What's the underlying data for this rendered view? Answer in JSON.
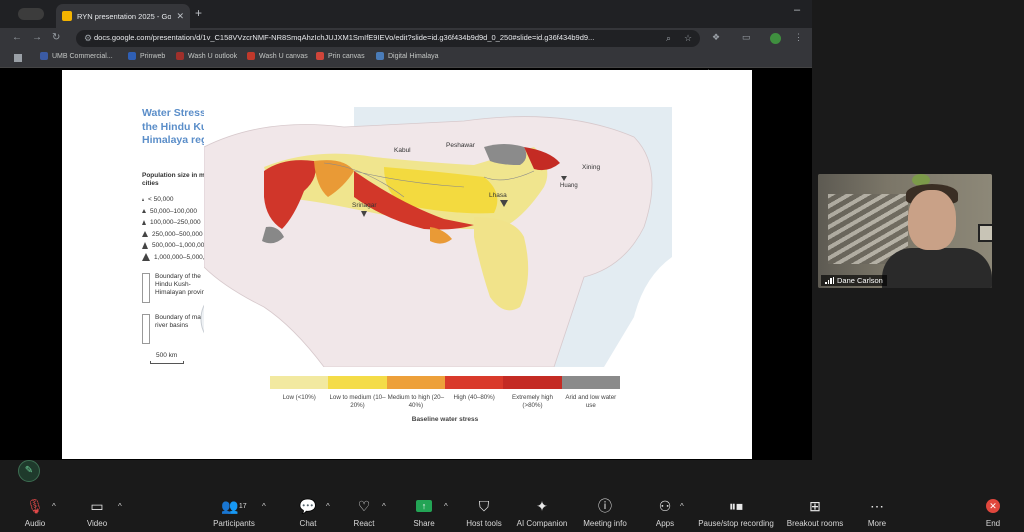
{
  "browser": {
    "tab_title": "RYN presentation 2025 - Goo",
    "tab_close": "✕",
    "new_tab": "+",
    "url": "docs.google.com/presentation/d/1v_C158VVzcrNMF-NR8SmqAhzIchJUJXM1SmIfE9IEVo/edit?slide=id.g36f434b9d9d_0_250#slide=id.g36f434b9d9...",
    "bookmarks": [
      {
        "label": "UMB Commercial...",
        "color": "#3b5ba5"
      },
      {
        "label": "Prinweb",
        "color": "#2f5fb5"
      },
      {
        "label": "Wash U outlook",
        "color": "#a0302b"
      },
      {
        "label": "Wash U canvas",
        "color": "#c0392b"
      },
      {
        "label": "Prin canvas",
        "color": "#d0453a"
      },
      {
        "label": "Digital Himalaya",
        "color": "#4a7cb8"
      }
    ]
  },
  "slide": {
    "map_title": "Water Stress in the Hindu Kush-Himalaya region",
    "population_heading": "Population size in main cities",
    "population_sizes": [
      "< 50,000",
      "50,000–100,000",
      "100,000–250,000",
      "250,000–500,000",
      "500,000–1,000,000",
      "1,000,000–5,000,000"
    ],
    "boundary_hkh": "Boundary of the Hindu Kush-Himalayan province",
    "boundary_basins": "Boundary of mayor river basins",
    "scale": "500 km",
    "place_labels": {
      "kabul": "Kabul",
      "peshawar": "Peshawar",
      "xining": "Xining",
      "lhasa": "Lhasa",
      "srinagar": "Srinagar",
      "huang": "Huang"
    },
    "legend": [
      {
        "label": "Low (<10%)",
        "color": "#f2e9a0"
      },
      {
        "label": "Low to medium (10–20%)",
        "color": "#f4dc48"
      },
      {
        "label": "Medium to high (20–40%)",
        "color": "#eda03a"
      },
      {
        "label": "High (40–80%)",
        "color": "#d93a2b"
      },
      {
        "label": "Extremely high (>80%)",
        "color": "#c42b24"
      },
      {
        "label": "Arid and low water use",
        "color": "#8a8a8a"
      }
    ],
    "legend_caption": "Baseline water stress"
  },
  "participant": {
    "name": "Dane Carlson"
  },
  "controls": {
    "audio": "Audio",
    "video": "Video",
    "participants": "Participants",
    "participant_count": "17",
    "chat": "Chat",
    "react": "React",
    "share": "Share",
    "host_tools": "Host tools",
    "ai_companion": "AI Companion",
    "meeting_info": "Meeting info",
    "apps": "Apps",
    "pause_recording": "Pause/stop recording",
    "breakout_rooms": "Breakout rooms",
    "more": "More",
    "end": "End"
  }
}
